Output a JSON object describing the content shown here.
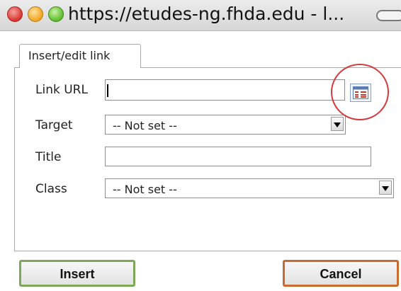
{
  "window": {
    "url_title": "https://etudes-ng.fhda.edu - l..."
  },
  "dialog": {
    "tab_label": "Insert/edit link",
    "fields": {
      "link_url_label": "Link URL",
      "link_url_value": "",
      "target_label": "Target",
      "target_value": "-- Not set --",
      "title_label": "Title",
      "title_value": "",
      "class_label": "Class",
      "class_value": "-- Not set --"
    },
    "browse_icon": "link-browser-icon",
    "buttons": {
      "insert": "Insert",
      "cancel": "Cancel"
    }
  },
  "colors": {
    "highlight_circle": "#d23b3b",
    "insert_border": "#7fa758",
    "cancel_border": "#c96a2e"
  }
}
